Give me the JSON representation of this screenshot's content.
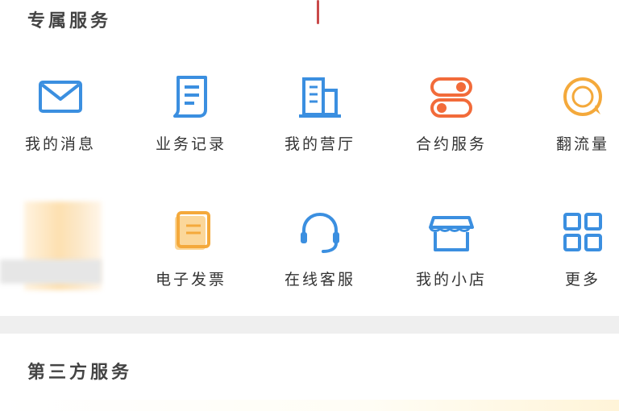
{
  "sections": {
    "system_services": {
      "title": "专属服务"
    },
    "third_party": {
      "title": "第三方服务"
    }
  },
  "services": [
    {
      "label": "我的消息",
      "icon": "envelope-icon",
      "color": "#3b8fe0"
    },
    {
      "label": "业务记录",
      "icon": "receipt-icon",
      "color": "#3b8fe0"
    },
    {
      "label": "我的营厅",
      "icon": "building-icon",
      "color": "#3b8fe0"
    },
    {
      "label": "合约服务",
      "icon": "toggle-switch-icon",
      "color": "#f26b3a"
    },
    {
      "label": "翻流量",
      "icon": "coin-icon",
      "color": "#f4a93b"
    },
    {
      "label": "",
      "icon": "blurred-item",
      "color": "#fde0b0"
    },
    {
      "label": "电子发票",
      "icon": "invoice-icon",
      "color": "#f4a93b"
    },
    {
      "label": "在线客服",
      "icon": "headset-icon",
      "color": "#3b8fe0"
    },
    {
      "label": "我的小店",
      "icon": "shop-icon",
      "color": "#3b8fe0"
    },
    {
      "label": "更多",
      "icon": "grid-icon",
      "color": "#3b8fe0"
    }
  ]
}
